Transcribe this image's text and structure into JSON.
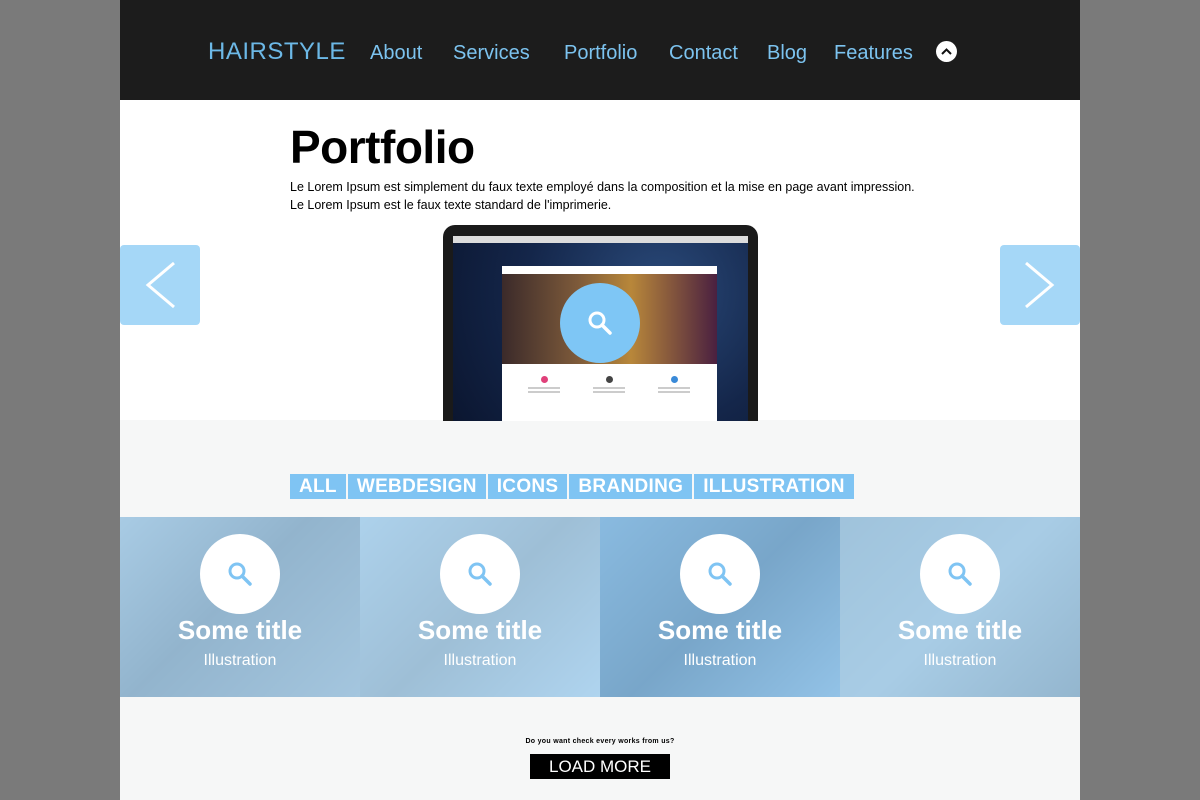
{
  "header": {
    "logo": "HAIRSTYLE",
    "nav": [
      "About",
      "Services",
      "Portfolio",
      "Contact",
      "Blog",
      "Features"
    ],
    "up_icon": "chevron-up-icon"
  },
  "hero": {
    "title": "Portfolio",
    "text_line1": "Le Lorem Ipsum est simplement du faux texte employé dans la composition et la mise en page avant impression.",
    "text_line2": "Le Lorem Ipsum est le faux texte standard de l'imprimerie.",
    "prev_icon": "chevron-left-icon",
    "next_icon": "chevron-right-icon",
    "search_icon": "search-icon"
  },
  "filters": [
    "ALL",
    "WEBDESIGN",
    "ICONS",
    "BRANDING",
    "ILLUSTRATION"
  ],
  "gallery": [
    {
      "title": "Some title",
      "category": "Illustration"
    },
    {
      "title": "Some title",
      "category": "Illustration"
    },
    {
      "title": "Some title",
      "category": "Illustration"
    },
    {
      "title": "Some title",
      "category": "Illustration"
    }
  ],
  "footer": {
    "question": "Do you want check every works from us?",
    "load_more": "LOAD MORE"
  },
  "colors": {
    "accent": "#7fc4f3",
    "header_bg": "#1c1c1c",
    "nav_text": "#7cc3ef"
  }
}
